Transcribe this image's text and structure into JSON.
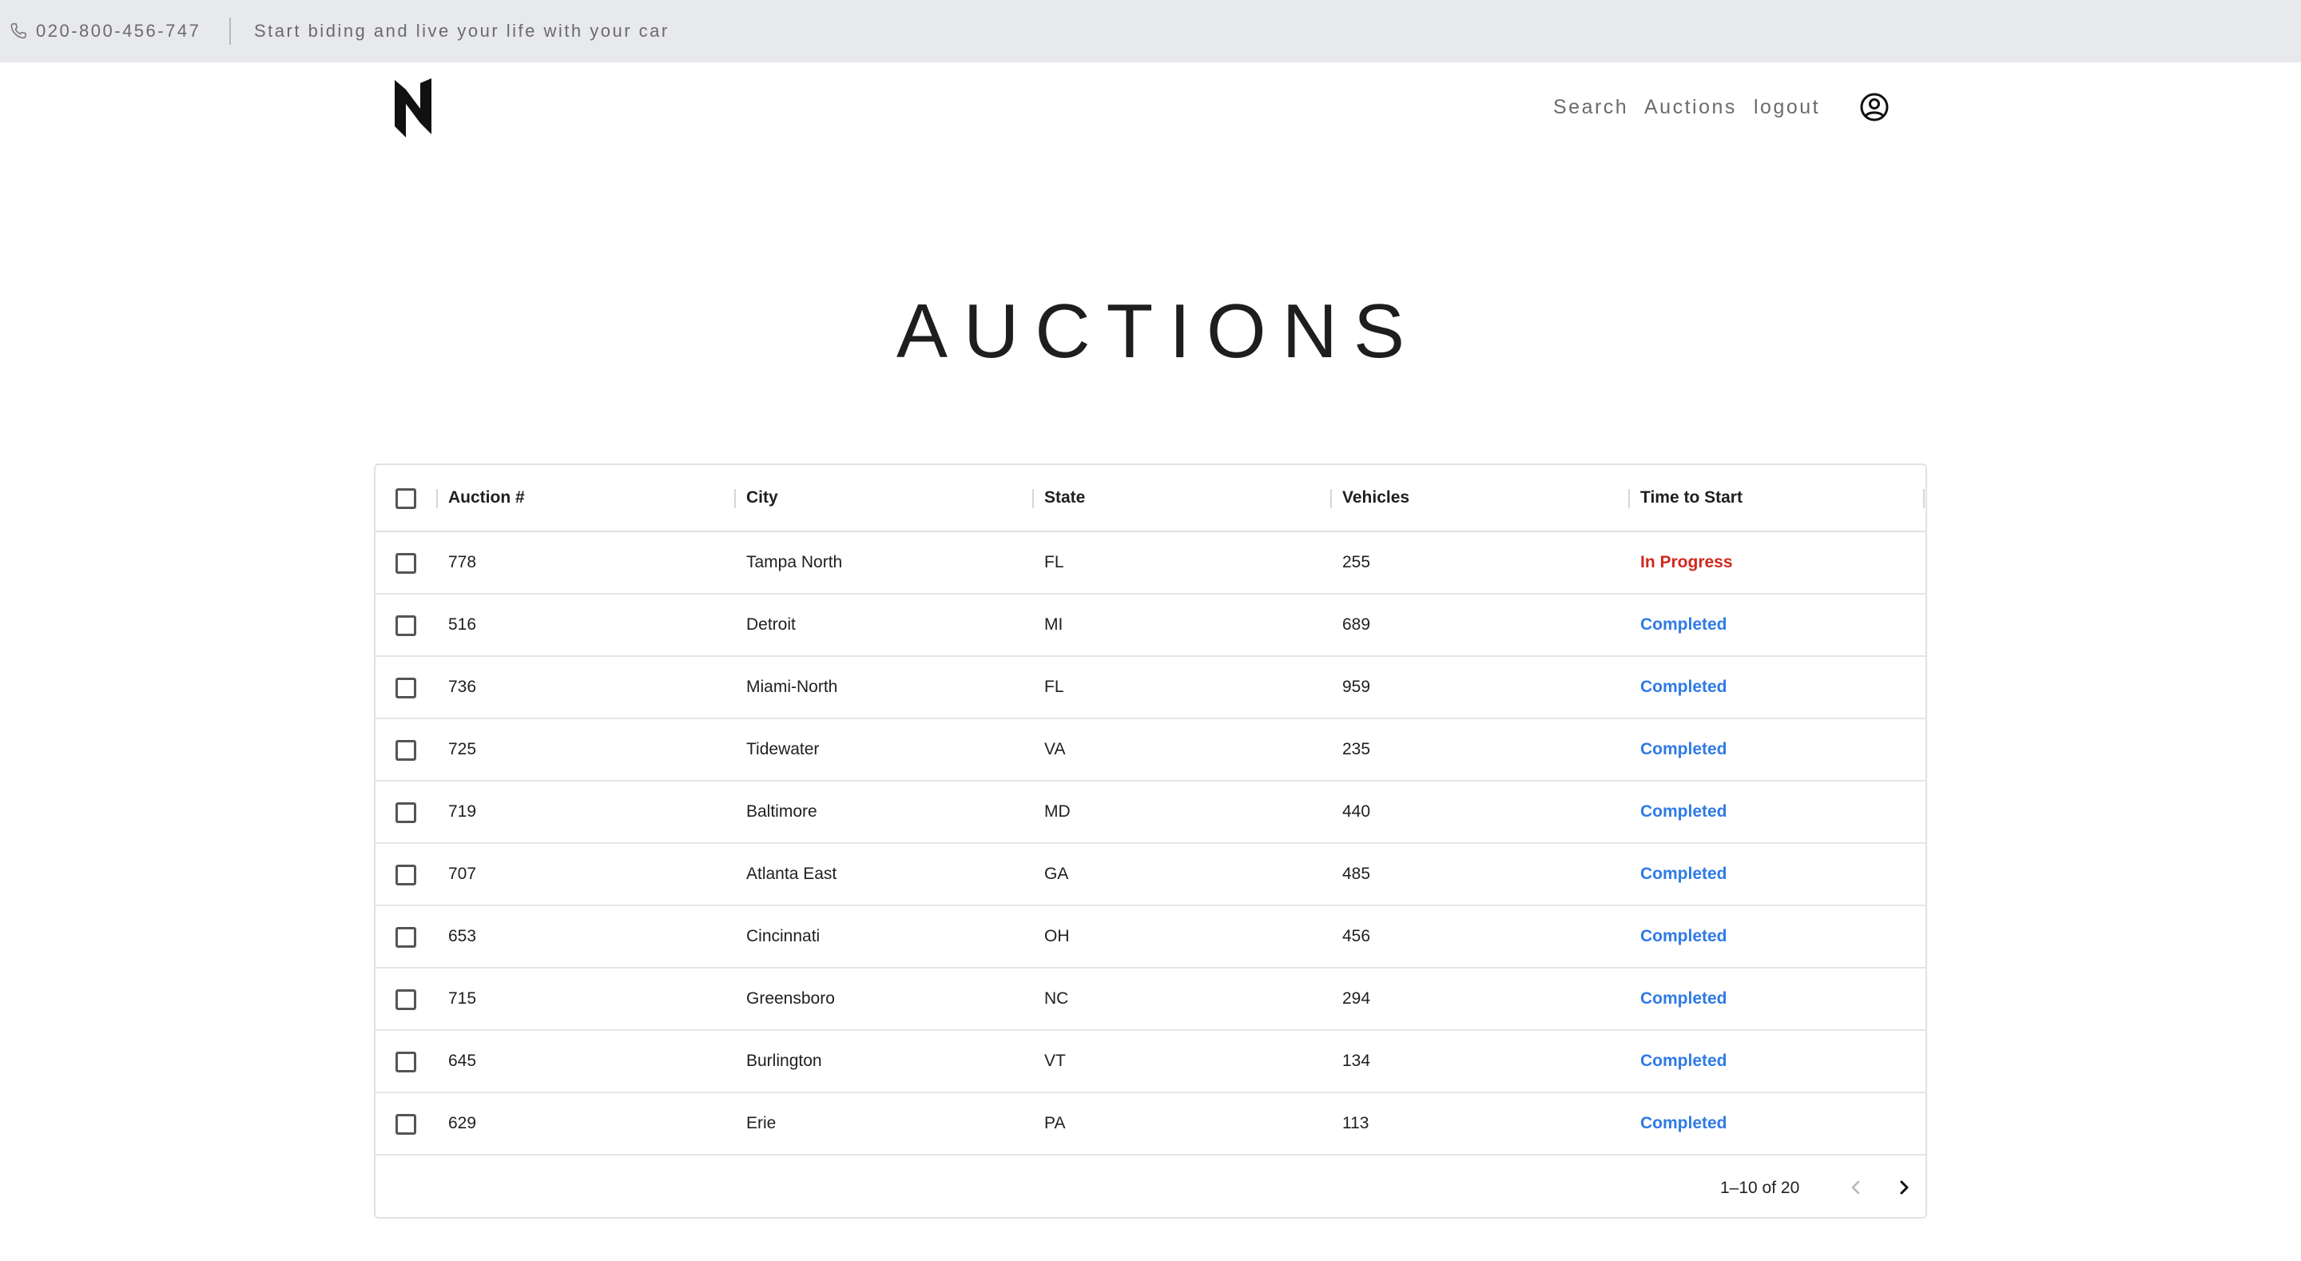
{
  "topbar": {
    "phone": "020-800-456-747",
    "tagline": "Start biding and live your life with your car"
  },
  "nav": {
    "search": "Search",
    "auctions": "Auctions",
    "logout": "logout"
  },
  "page": {
    "title": "AUCTIONS"
  },
  "table": {
    "columns": [
      "Auction #",
      "City",
      "State",
      "Vehicles",
      "Time to Start"
    ],
    "rows": [
      {
        "auction": "778",
        "city": "Tampa North",
        "state": "FL",
        "vehicles": "255",
        "time": "In Progress"
      },
      {
        "auction": "516",
        "city": "Detroit",
        "state": "MI",
        "vehicles": "689",
        "time": "Completed"
      },
      {
        "auction": "736",
        "city": "Miami-North",
        "state": "FL",
        "vehicles": "959",
        "time": "Completed"
      },
      {
        "auction": "725",
        "city": "Tidewater",
        "state": "VA",
        "vehicles": "235",
        "time": "Completed"
      },
      {
        "auction": "719",
        "city": "Baltimore",
        "state": "MD",
        "vehicles": "440",
        "time": "Completed"
      },
      {
        "auction": "707",
        "city": "Atlanta East",
        "state": "GA",
        "vehicles": "485",
        "time": "Completed"
      },
      {
        "auction": "653",
        "city": "Cincinnati",
        "state": "OH",
        "vehicles": "456",
        "time": "Completed"
      },
      {
        "auction": "715",
        "city": "Greensboro",
        "state": "NC",
        "vehicles": "294",
        "time": "Completed"
      },
      {
        "auction": "645",
        "city": "Burlington",
        "state": "VT",
        "vehicles": "134",
        "time": "Completed"
      },
      {
        "auction": "629",
        "city": "Erie",
        "state": "PA",
        "vehicles": "113",
        "time": "Completed"
      }
    ],
    "pagination": "1–10 of 20"
  },
  "colors": {
    "in_progress": "#d2281e",
    "completed": "#2f7ae6",
    "topbar_bg": "#e8e9ec"
  },
  "icons": {
    "phone": "phone-icon",
    "logo": "brand-logo",
    "account": "account-circle-icon",
    "prev": "chevron-left-icon",
    "next": "chevron-right-icon"
  }
}
